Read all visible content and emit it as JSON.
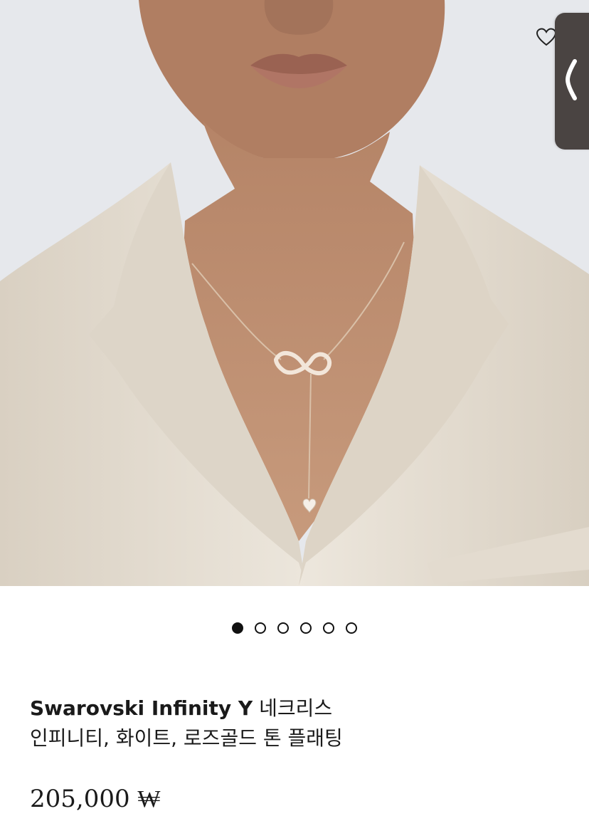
{
  "product": {
    "title_brand": "Swarovski Infinity Y",
    "title_rest_line1": "네크리스",
    "title_line2": "인피니티, 화이트, 로즈골드 톤 플래팅",
    "price": "205,000 ₩"
  },
  "gallery": {
    "image_count": 6,
    "active_index": 0
  },
  "icons": {
    "wishlist": "heart-outline-icon",
    "side_handle": "chevron-left-icon"
  },
  "colors": {
    "handle_bg": "#4a4442",
    "jacket": "#e8e1d6",
    "background": "#e6e8ec"
  }
}
